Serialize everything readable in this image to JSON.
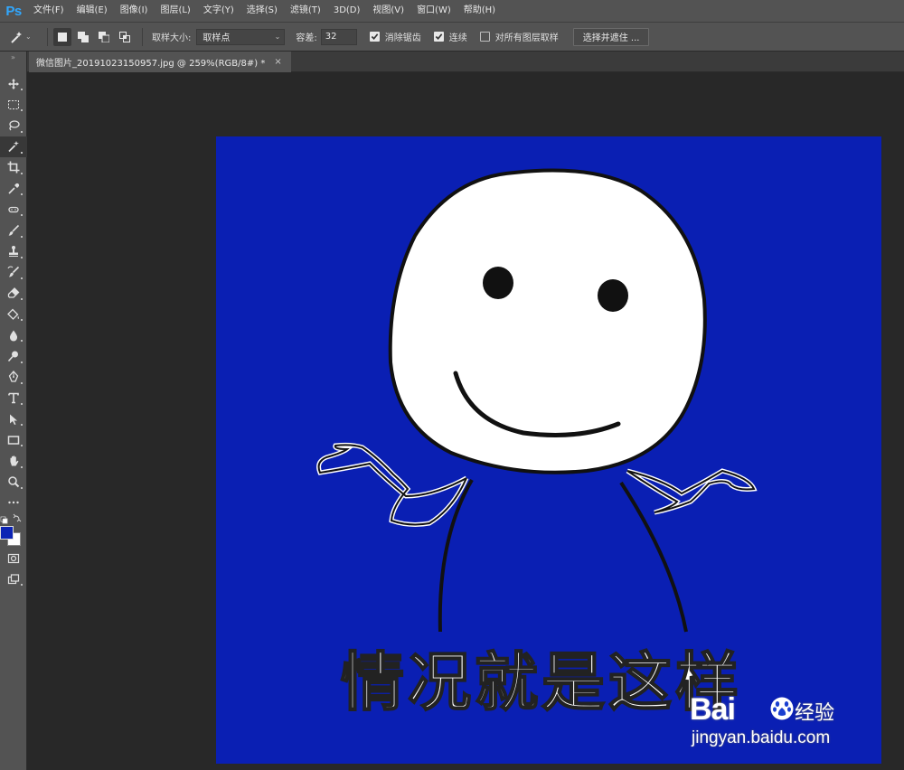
{
  "app": {
    "logo": "Ps"
  },
  "menu": [
    {
      "label": "文件(F)"
    },
    {
      "label": "编辑(E)"
    },
    {
      "label": "图像(I)"
    },
    {
      "label": "图层(L)"
    },
    {
      "label": "文字(Y)"
    },
    {
      "label": "选择(S)"
    },
    {
      "label": "滤镜(T)"
    },
    {
      "label": "3D(D)"
    },
    {
      "label": "视图(V)"
    },
    {
      "label": "窗口(W)"
    },
    {
      "label": "帮助(H)"
    }
  ],
  "options": {
    "sample_size_label": "取样大小:",
    "sample_size_value": "取样点",
    "tolerance_label": "容差:",
    "tolerance_value": "32",
    "antialias_label": "消除锯齿",
    "antialias_checked": true,
    "contiguous_label": "连续",
    "contiguous_checked": true,
    "sample_all_layers_label": "对所有图层取样",
    "sample_all_layers_checked": false,
    "select_mask_label": "选择并遮住 ..."
  },
  "document": {
    "tab_title": "微信图片_20191023150957.jpg @ 259%(RGB/8#) *",
    "close_glyph": "×",
    "canvas_caption": "情况就是这样"
  },
  "colors": {
    "foreground": "#0c24b4",
    "background": "#ffffff",
    "canvas_bg": "#0a1fb3",
    "ui_panel": "#535353",
    "workspace": "#282828"
  },
  "watermark": {
    "logo_text": "Bai",
    "logo_text2": "经验",
    "url": "jingyan.baidu.com"
  },
  "tools": [
    "move-tool-icon",
    "marquee-tool-icon",
    "lasso-tool-icon",
    "magic-wand-tool-icon",
    "crop-tool-icon",
    "eyedropper-tool-icon",
    "healing-brush-tool-icon",
    "brush-tool-icon",
    "clone-stamp-tool-icon",
    "history-brush-tool-icon",
    "eraser-tool-icon",
    "paint-bucket-tool-icon",
    "blur-tool-icon",
    "dodge-tool-icon",
    "pen-tool-icon",
    "type-tool-icon",
    "path-selection-tool-icon",
    "rectangle-tool-icon",
    "hand-tool-icon",
    "zoom-tool-icon",
    "more-tools-icon"
  ]
}
